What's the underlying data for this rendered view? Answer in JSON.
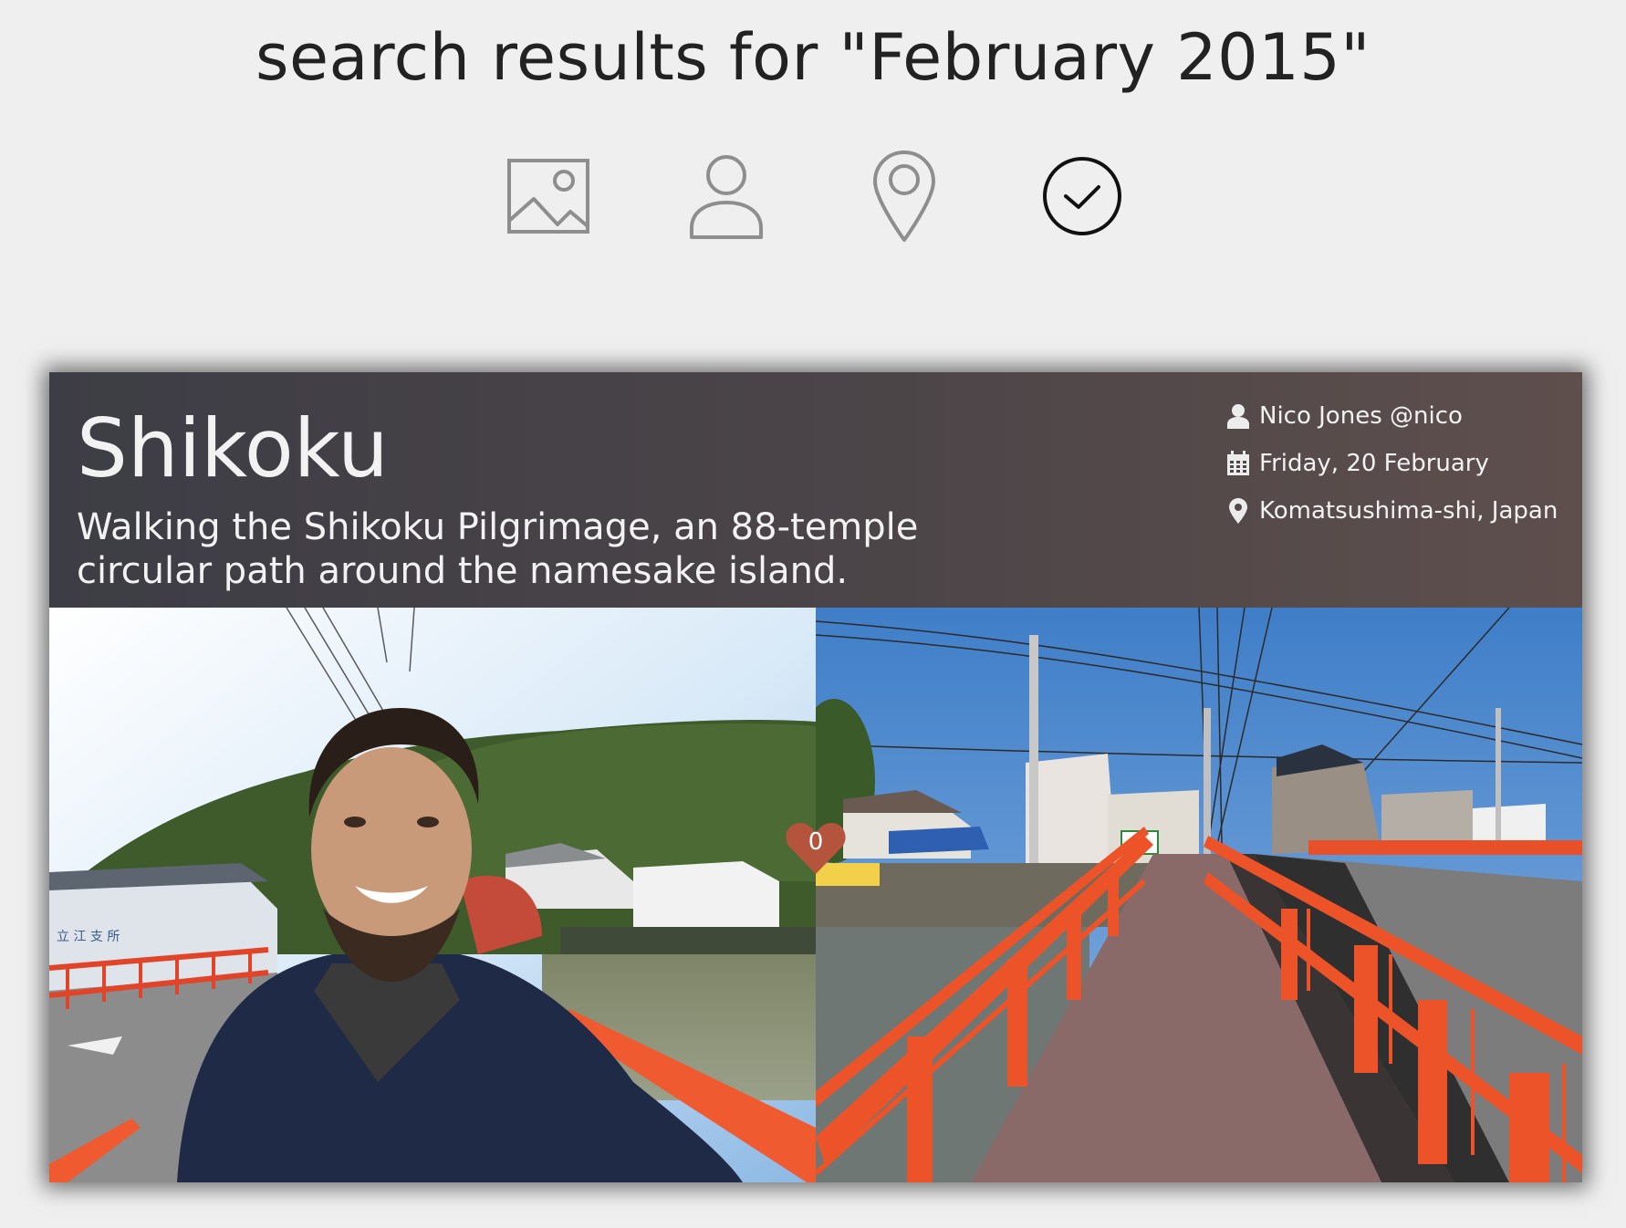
{
  "search": {
    "title": "search results for \"February 2015\""
  },
  "filters": [
    {
      "icon": "image-icon",
      "active": false
    },
    {
      "icon": "person-icon",
      "active": false
    },
    {
      "icon": "location-pin-icon",
      "active": false
    },
    {
      "icon": "clock-icon",
      "active": true
    }
  ],
  "colors": {
    "background": "#efefef",
    "header_gradient_start": "#3d3d45",
    "header_gradient_end": "#5e4f4d",
    "like_heart": "#b5543c",
    "inactive_icon": "#8e8e8e",
    "active_icon": "#111111"
  },
  "card": {
    "title": "Shikoku",
    "description": "Walking the Shikoku Pilgrimage, an 88-temple circular path around the namesake island.",
    "author": "Nico Jones @nico",
    "date": "Friday, 20 February",
    "location": "Komatsushima-shi, Japan",
    "likes": "0",
    "meta_icons": [
      "user-icon",
      "calendar-icon",
      "map-pin-icon"
    ]
  }
}
